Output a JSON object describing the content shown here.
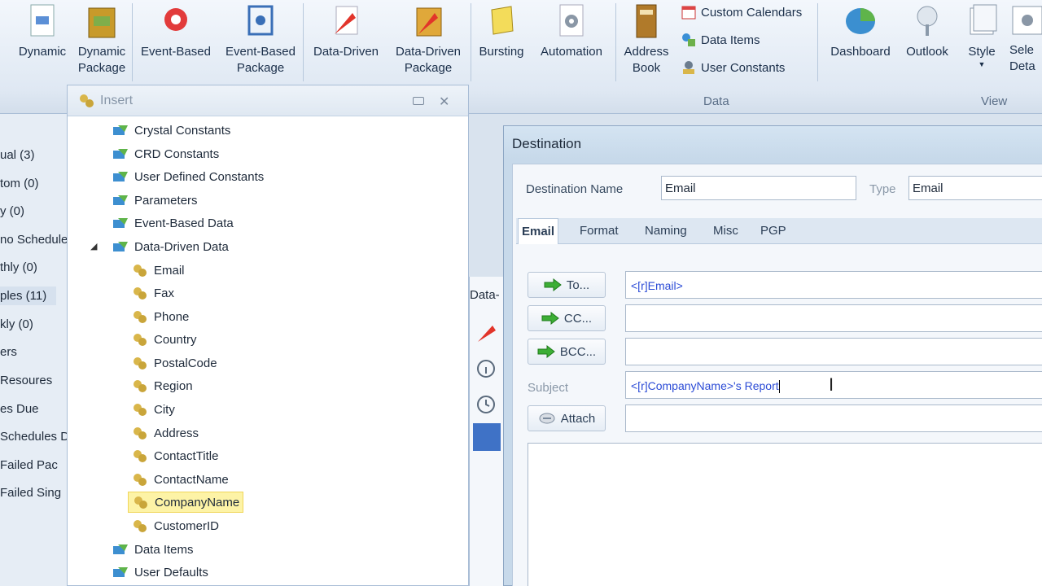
{
  "ribbon": {
    "buttons": [
      {
        "label": "Dynamic",
        "icon": "dynamic-icon"
      },
      {
        "label": "Dynamic\nPackage",
        "icon": "package-icon"
      },
      {
        "label": "Event-Based",
        "icon": "event-icon"
      },
      {
        "label": "Event-Based\nPackage",
        "icon": "event-package-icon"
      },
      {
        "label": "Data-Driven",
        "icon": "data-driven-icon"
      },
      {
        "label": "Data-Driven\nPackage",
        "icon": "data-driven-package-icon"
      },
      {
        "label": "Bursting",
        "icon": "bursting-icon"
      },
      {
        "label": "Automation",
        "icon": "gear-icon"
      },
      {
        "label": "Address\nBook",
        "icon": "address-book-icon"
      },
      {
        "label": "Dashboard",
        "icon": "dashboard-icon"
      },
      {
        "label": "Outlook",
        "icon": "outlook-icon"
      },
      {
        "label": "Style",
        "icon": "style-icon"
      },
      {
        "label": "Sele\nDeta",
        "icon": "select-details-icon"
      }
    ],
    "data_items": [
      {
        "label": "Custom Calendars",
        "icon": "calendar-icon"
      },
      {
        "label": "Data Items",
        "icon": "data-items-icon"
      },
      {
        "label": "User Constants",
        "icon": "user-constants-icon"
      }
    ],
    "groups": {
      "data": "Data",
      "view": "View"
    }
  },
  "leftnav": [
    "ual (3)",
    "tom (0)",
    "y (0)",
    "no Schedule",
    "thly (0)",
    "ples (11)",
    "kly (0)",
    "ers",
    "Resoures",
    "es Due",
    "Schedules D",
    "Failed Pac",
    "Failed Sing"
  ],
  "insert": {
    "title": "Insert",
    "tree": [
      {
        "label": "Crystal Constants",
        "level": 0
      },
      {
        "label": "CRD Constants",
        "level": 0
      },
      {
        "label": "User Defined Constants",
        "level": 0
      },
      {
        "label": "Parameters",
        "level": 0
      },
      {
        "label": "Event-Based Data",
        "level": 0
      },
      {
        "label": "Data-Driven Data",
        "level": 0,
        "expanded": true
      },
      {
        "label": "Email",
        "level": 1
      },
      {
        "label": "Fax",
        "level": 1
      },
      {
        "label": "Phone",
        "level": 1
      },
      {
        "label": "Country",
        "level": 1
      },
      {
        "label": "PostalCode",
        "level": 1
      },
      {
        "label": "Region",
        "level": 1
      },
      {
        "label": "City",
        "level": 1
      },
      {
        "label": "Address",
        "level": 1
      },
      {
        "label": "ContactTitle",
        "level": 1
      },
      {
        "label": "ContactName",
        "level": 1
      },
      {
        "label": "CompanyName",
        "level": 1,
        "selected": true
      },
      {
        "label": "CustomerID",
        "level": 1
      },
      {
        "label": "Data Items",
        "level": 0
      },
      {
        "label": "User Defaults",
        "level": 0
      }
    ]
  },
  "midpanel": {
    "title": "Data-"
  },
  "destination": {
    "title": "Destination",
    "name_label": "Destination Name",
    "name_value": "Email",
    "type_label": "Type",
    "type_value": "Email",
    "tabs": [
      "Email",
      "Format",
      "Naming",
      "Misc",
      "PGP"
    ],
    "to_label": "To...",
    "cc_label": "CC...",
    "bcc_label": "BCC...",
    "subject_label": "Subject",
    "attach_label": "Attach",
    "to_value": "<[r]Email>",
    "cc_value": "",
    "bcc_value": "",
    "subject_value": "<[r]CompanyName>'s Report",
    "attach_value": ""
  },
  "colors": {
    "accent": "#3f72c6",
    "selection": "#fdf3a6",
    "token": "#2b4bd6"
  }
}
